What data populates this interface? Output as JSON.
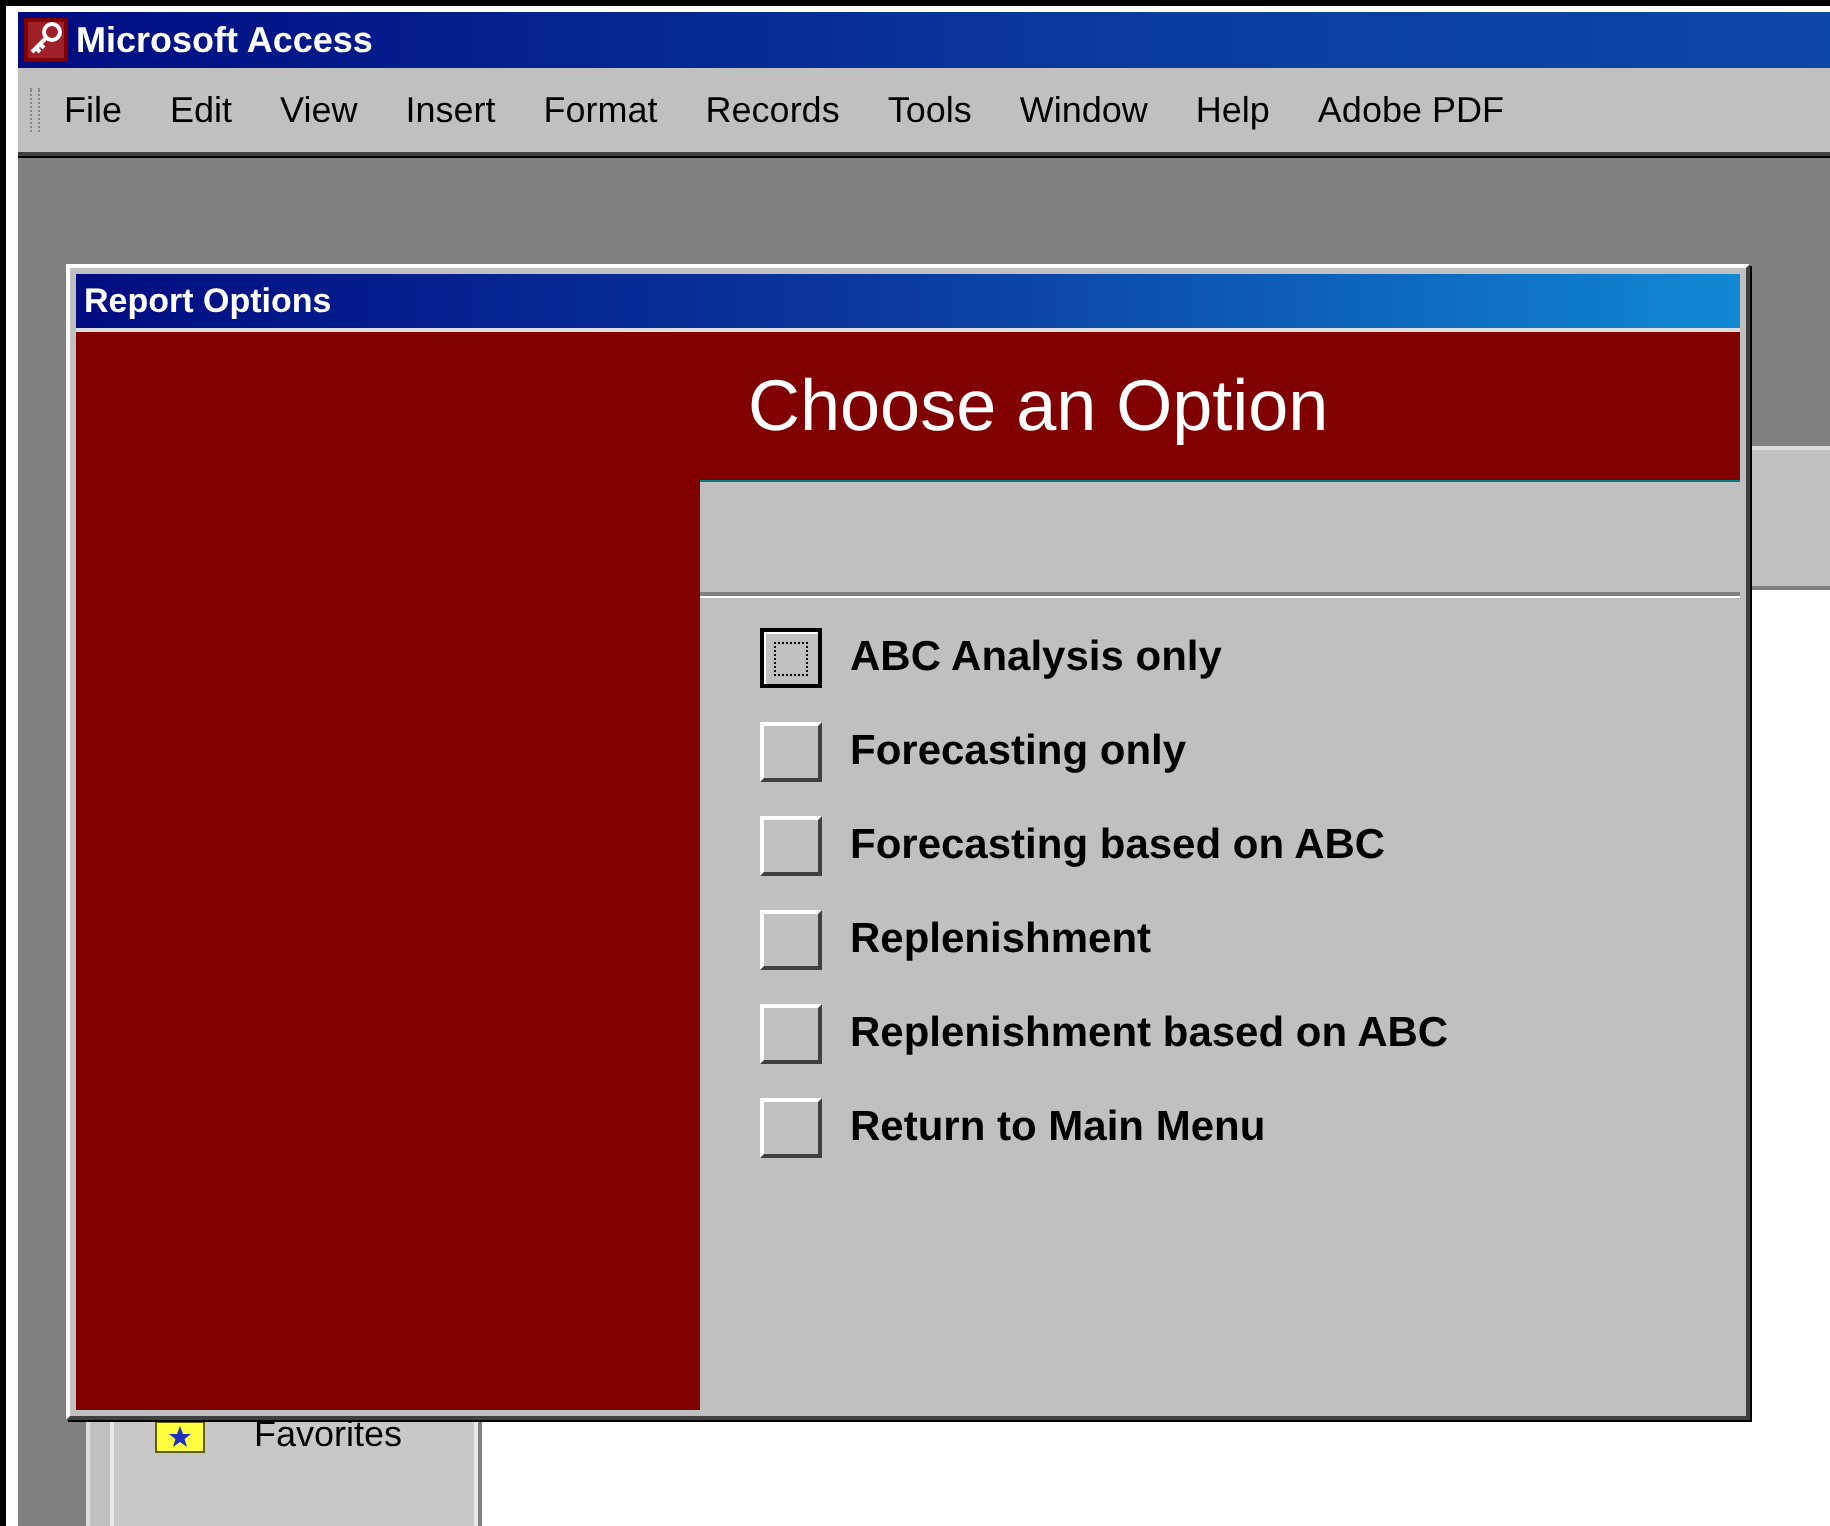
{
  "window": {
    "title": "Microsoft Access"
  },
  "menu": [
    {
      "label": "File"
    },
    {
      "label": "Edit"
    },
    {
      "label": "View"
    },
    {
      "label": "Insert"
    },
    {
      "label": "Format"
    },
    {
      "label": "Records"
    },
    {
      "label": "Tools"
    },
    {
      "label": "Window"
    },
    {
      "label": "Help"
    },
    {
      "label": "Adobe PDF"
    }
  ],
  "database_window": {
    "groups": [
      {
        "label": "Favorites"
      }
    ]
  },
  "dialog": {
    "title": "Report Options",
    "heading": "Choose an Option",
    "options": [
      {
        "label": "ABC Analysis only",
        "selected": true
      },
      {
        "label": "Forecasting only",
        "selected": false
      },
      {
        "label": "Forecasting based on ABC",
        "selected": false
      },
      {
        "label": "Replenishment",
        "selected": false
      },
      {
        "label": "Replenishment based on ABC",
        "selected": false
      },
      {
        "label": "Return to Main Menu",
        "selected": false
      }
    ]
  }
}
